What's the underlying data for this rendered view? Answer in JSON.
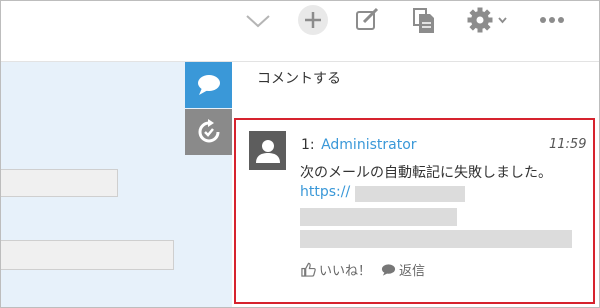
{
  "toolbar": {
    "icons": [
      "chevron-down-icon",
      "add-icon",
      "compose-icon",
      "document-icon",
      "gear-icon",
      "more-icon"
    ]
  },
  "side_tabs": [
    "comment-bubble-icon",
    "history-icon"
  ],
  "comments": {
    "heading": "コメントする",
    "entry": {
      "number": "1:",
      "author": "Administrator",
      "time": "11:59",
      "message": "次のメールの自動転記に失敗しました。",
      "link_prefix": "https://",
      "like_label": "いいね！",
      "reply_label": "返信"
    }
  },
  "colors": {
    "accent": "#3a98d8",
    "highlight": "#d6232e",
    "left_panel": "#e7f1fa",
    "history_tab": "#8a8a8a"
  }
}
